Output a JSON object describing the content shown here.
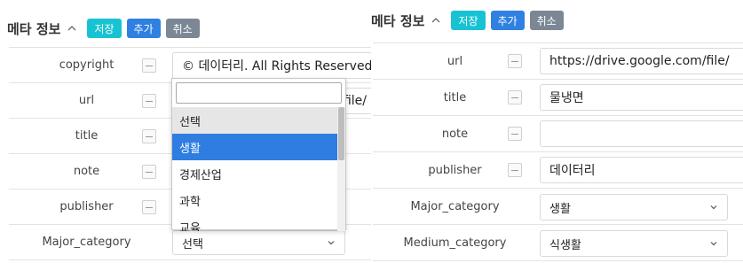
{
  "left": {
    "header": {
      "title": "메타 정보",
      "save_label": "저장",
      "add_label": "추가",
      "cancel_label": "취소"
    },
    "rows": [
      {
        "label": "copyright",
        "value": "© 데이터리. All Rights Reserved"
      },
      {
        "label": "url",
        "value_visible_tail": "file/"
      },
      {
        "label": "title"
      },
      {
        "label": "note"
      },
      {
        "label": "publisher"
      },
      {
        "label": "Major_category",
        "select_value": "선택"
      }
    ],
    "dropdown": {
      "search_value": "",
      "options": [
        "선택",
        "생활",
        "경제산업",
        "과학",
        "교육"
      ],
      "hover_index": 0,
      "selected_index": 1
    }
  },
  "right": {
    "header": {
      "title": "메타 정보",
      "save_label": "저장",
      "add_label": "추가",
      "cancel_label": "취소"
    },
    "rows": [
      {
        "label": "url",
        "value": "https://drive.google.com/file/"
      },
      {
        "label": "title",
        "value": "물냉면"
      },
      {
        "label": "note",
        "value": ""
      },
      {
        "label": "publisher",
        "value": "데이터리"
      },
      {
        "label": "Major_category",
        "select_value": "생활"
      },
      {
        "label": "Medium_category",
        "select_value": "식생활"
      }
    ]
  },
  "colors": {
    "save": "#17c3d3",
    "add": "#2f80e1",
    "cancel": "#7b8794",
    "selected_option": "#2f7de1"
  },
  "icons": {
    "caret": "caret-up-icon",
    "remove": "minus-icon",
    "select_arrow": "chevron-down-icon"
  }
}
